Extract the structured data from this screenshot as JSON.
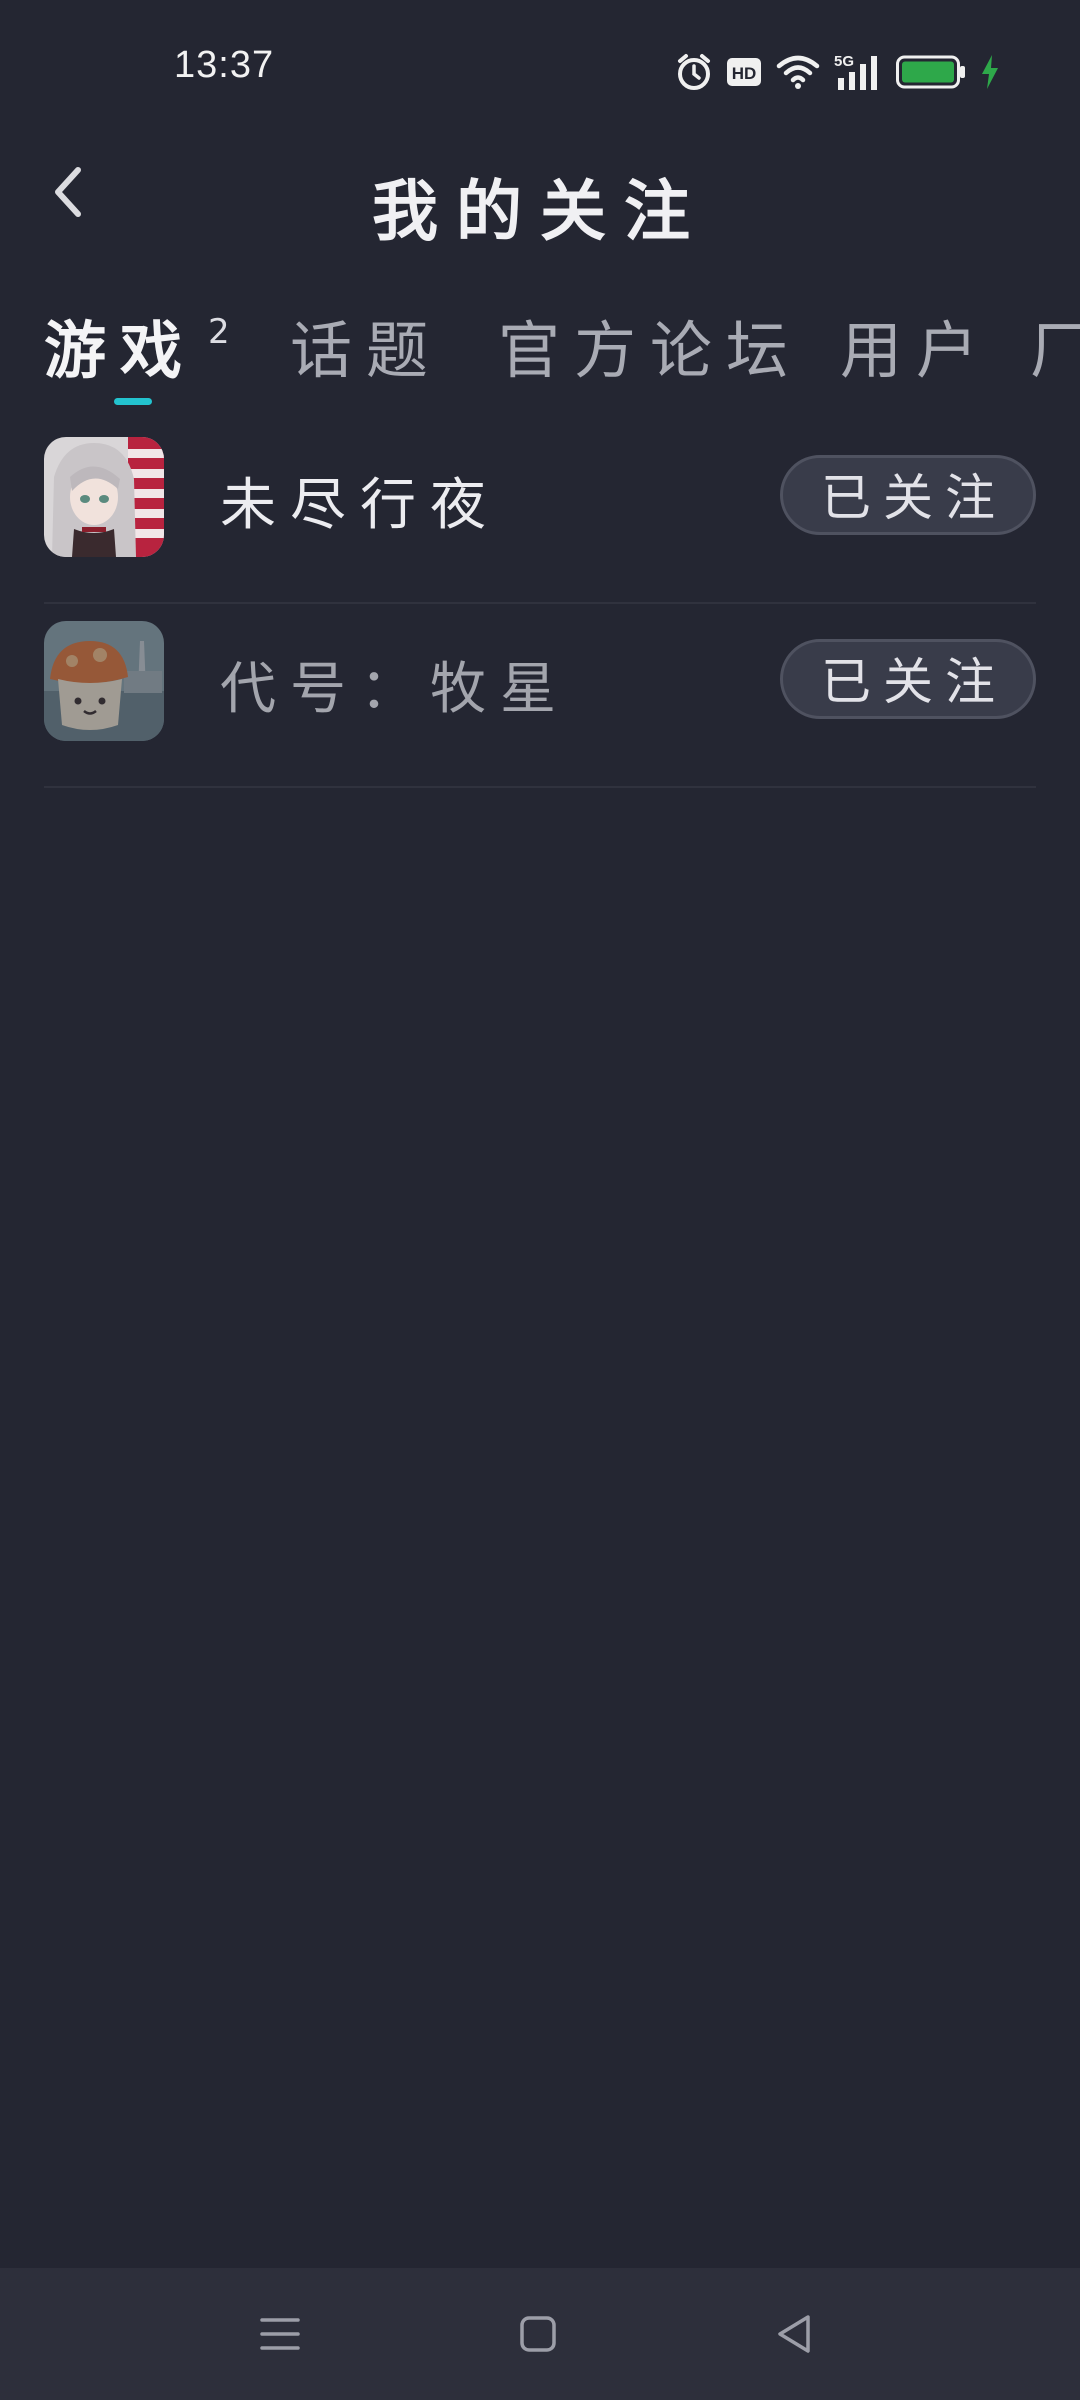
{
  "status_bar": {
    "time": "13:37",
    "icons": [
      "alarm-icon",
      "hd-icon",
      "wifi-icon",
      "signal-5g-icon",
      "battery-icon",
      "charging-icon"
    ],
    "hd_label": "HD",
    "network_label": "5G",
    "battery_color": "#2ea84a"
  },
  "header": {
    "title": "我的关注",
    "back_icon": "chevron-left-icon"
  },
  "tabs": {
    "items": [
      {
        "label": "游戏",
        "badge": "2",
        "active": true
      },
      {
        "label": "话题"
      },
      {
        "label": "官方论坛"
      },
      {
        "label": "用户"
      },
      {
        "label": "厂"
      }
    ],
    "indicator_color": "#23c3cf"
  },
  "games": [
    {
      "name": "未尽行夜",
      "button": "已关注"
    },
    {
      "name": "代号：牧星",
      "button": "已关注"
    }
  ],
  "nav_bar": {
    "icons": [
      "menu-icon",
      "home-square-icon",
      "back-triangle-icon"
    ]
  }
}
